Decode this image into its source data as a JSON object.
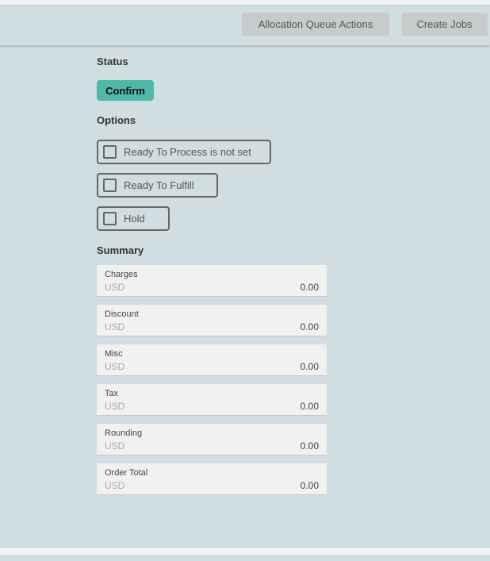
{
  "header": {
    "allocation_label": "Allocation Queue Actions",
    "create_jobs_label": "Create Jobs"
  },
  "status": {
    "label": "Status",
    "confirm_label": "Confirm"
  },
  "options": {
    "label": "Options",
    "items": [
      {
        "label": "Ready To Process is not set",
        "checked": false
      },
      {
        "label": "Ready To Fulfill",
        "checked": false
      },
      {
        "label": "Hold",
        "checked": false
      }
    ]
  },
  "summary": {
    "label": "Summary",
    "items": [
      {
        "title": "Charges",
        "currency": "USD",
        "value": "0.00"
      },
      {
        "title": "Discount",
        "currency": "USD",
        "value": "0.00"
      },
      {
        "title": "Misc",
        "currency": "USD",
        "value": "0.00"
      },
      {
        "title": "Tax",
        "currency": "USD",
        "value": "0.00"
      },
      {
        "title": "Rounding",
        "currency": "USD",
        "value": "0.00"
      },
      {
        "title": "Order Total",
        "currency": "USD",
        "value": "0.00"
      }
    ]
  }
}
